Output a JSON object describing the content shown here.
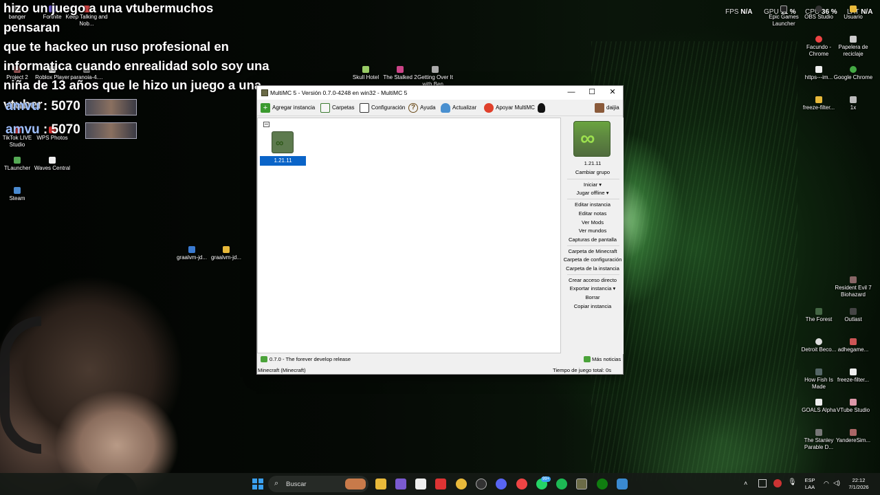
{
  "stream_overlay": {
    "lines": [
      "hizo un juego a una vtubermuchos pensaran",
      "que te hackeo un ruso profesional en",
      "informatica cuando enrealidad solo soy una",
      "niña de 13 años que le hizo un juego a una",
      "vtuber"
    ],
    "donations": [
      {
        "name": "amvu",
        "amount": ": 5070"
      },
      {
        "name": "amvu",
        "amount": ": 5070"
      }
    ]
  },
  "hud": {
    "fps_label": "FPS",
    "fps_value": "N/A",
    "gpu_label": "GPU",
    "gpu_value": "11 %",
    "cpu_label": "CPU",
    "cpu_value": "36 %",
    "lat_label": "LAT",
    "lat_value": "N/A"
  },
  "desktop_icons_left": [
    {
      "label": "banger"
    },
    {
      "label": "Fortnite"
    },
    {
      "label": "Keep Talking and Nob..."
    },
    {
      "label": "Project 2"
    },
    {
      "label": "Roblox Player"
    },
    {
      "label": "paranoia-4...."
    },
    {
      "label": "TikTok LIVE Studio"
    },
    {
      "label": "WPS Photos"
    },
    {
      "label": "TLauncher"
    },
    {
      "label": "Waves Central"
    },
    {
      "label": "Steam"
    },
    {
      "label": "graalvm-jd..."
    },
    {
      "label": "graalvm-jd..."
    },
    {
      "label": "Skull Hotel"
    },
    {
      "label": "The Stalked 2"
    },
    {
      "label": "Getting Over It with Ben..."
    }
  ],
  "desktop_icons_right": [
    {
      "label": "Epic Games Launcher"
    },
    {
      "label": "OBS Studio"
    },
    {
      "label": "Usuario"
    },
    {
      "label": "Facundo - Chrome"
    },
    {
      "label": "Papelera de reciclaje"
    },
    {
      "label": "https---im..."
    },
    {
      "label": "Google Chrome"
    },
    {
      "label": "freeze-filter..."
    },
    {
      "label": "1x"
    },
    {
      "label": "Resident Evil 7 Biohazard"
    },
    {
      "label": "The Forest"
    },
    {
      "label": "Outlast"
    },
    {
      "label": "Detroit Beco..."
    },
    {
      "label": "adhegame..."
    },
    {
      "label": "How Fish Is Made"
    },
    {
      "label": "freeze-filter..."
    },
    {
      "label": "GOALS Alpha"
    },
    {
      "label": "VTube Studio"
    },
    {
      "label": "The Stanley Parable D..."
    },
    {
      "label": "YandereSim..."
    }
  ],
  "window": {
    "title": "MultiMC 5 - Versión 0.7.0-4248 en win32 - MultiMC 5",
    "toolbar": {
      "add_instance": "Agregar instancia",
      "folders": "Carpetas",
      "settings": "Configuración",
      "help": "Ayuda",
      "update": "Actualizar",
      "support": "Apoyar MultiMC",
      "account": "daijia"
    },
    "instance": {
      "name": "1.21.11"
    },
    "side": {
      "instance_name": "1.21.11",
      "change_group": "Cambiar grupo",
      "launch": "Iniciar",
      "launch_offline": "Jugar offline",
      "edit_instance": "Editar instancia",
      "edit_notes": "Editar notas",
      "view_mods": "Ver Mods",
      "view_worlds": "Ver mundos",
      "screenshots": "Capturas de pantalla",
      "minecraft_folder": "Carpeta de Minecraft",
      "config_folder": "Carpeta de configuración",
      "instance_folder": "Carpeta de la instancia",
      "create_shortcut": "Crear acceso directo",
      "export_instance": "Exportar instancia",
      "delete": "Borrar",
      "copy_instance": "Copiar instancia"
    },
    "status": {
      "news": "0.7.0 - The forever develop release",
      "more_news": "Más noticias",
      "instance_info": "Minecraft  (Minecraft)",
      "play_time": "Tiempo de juego total: 0s"
    }
  },
  "taskbar": {
    "search_placeholder": "Buscar",
    "notif_badge": "99+",
    "lang_top": "ESP",
    "lang_bottom": "LAA",
    "time": "22:12",
    "date": "7/1/2026"
  }
}
